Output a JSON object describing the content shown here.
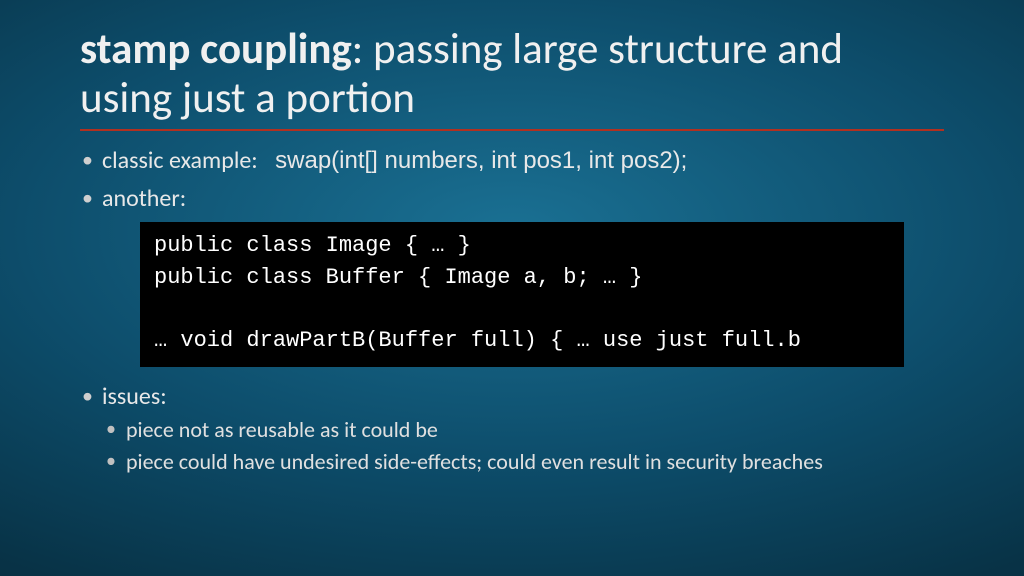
{
  "title": {
    "bold": "stamp coupling",
    "rest": ": passing large structure and using just a portion"
  },
  "bullets": {
    "classic_label": "classic example:",
    "classic_code": "swap(int[] numbers, int pos1, int pos2);",
    "another": "another:",
    "issues_label": "issues:",
    "issues": [
      "piece not as reusable as it could be",
      "piece could have undesired side-effects; could even result in security breaches"
    ]
  },
  "code": {
    "line1": "public class Image { … }",
    "line2": "public class Buffer { Image a, b; … }",
    "line3": "",
    "line4": "… void drawPartB(Buffer full) { … use just full.b"
  }
}
